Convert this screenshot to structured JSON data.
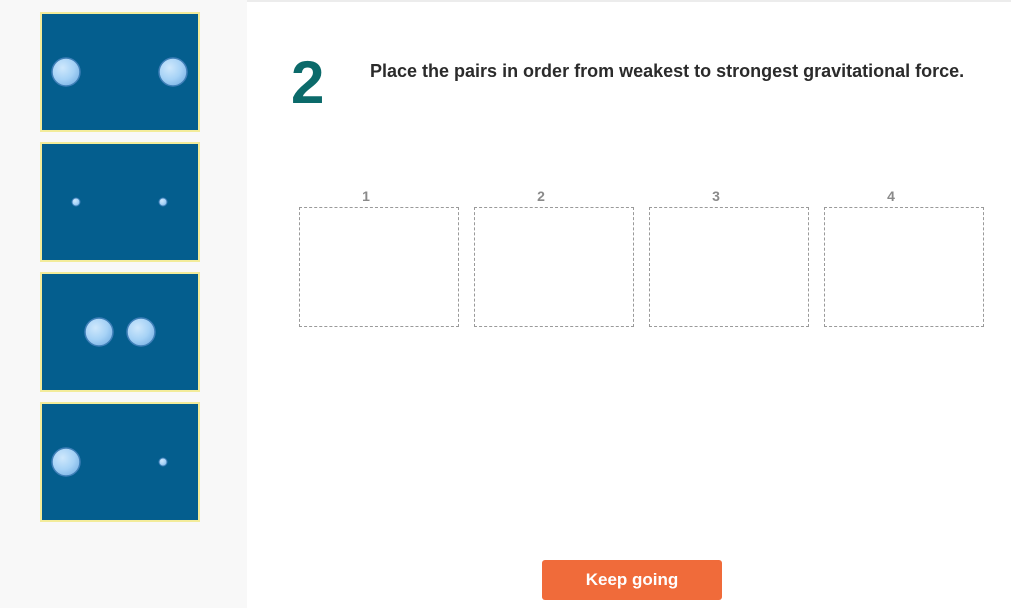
{
  "question": {
    "number": "2",
    "text": "Place the pairs in order from weakest to strongest gravitational force."
  },
  "slots": [
    {
      "label": "1"
    },
    {
      "label": "2"
    },
    {
      "label": "3"
    },
    {
      "label": "4"
    }
  ],
  "cards": [
    {
      "description": "two large spheres far apart",
      "icon": "sphere-pair-large-far"
    },
    {
      "description": "two small spheres far apart",
      "icon": "sphere-pair-small-far"
    },
    {
      "description": "two large spheres close together",
      "icon": "sphere-pair-large-close"
    },
    {
      "description": "one large and one small sphere far apart",
      "icon": "sphere-pair-mixed-far"
    }
  ],
  "actions": {
    "keep_going_label": "Keep going"
  },
  "colors": {
    "card_background": "#045e8e",
    "card_border": "#f3ec9a",
    "sphere": "#a9d4f7",
    "question_number": "#0b6a6a",
    "button": "#f06b3a"
  }
}
